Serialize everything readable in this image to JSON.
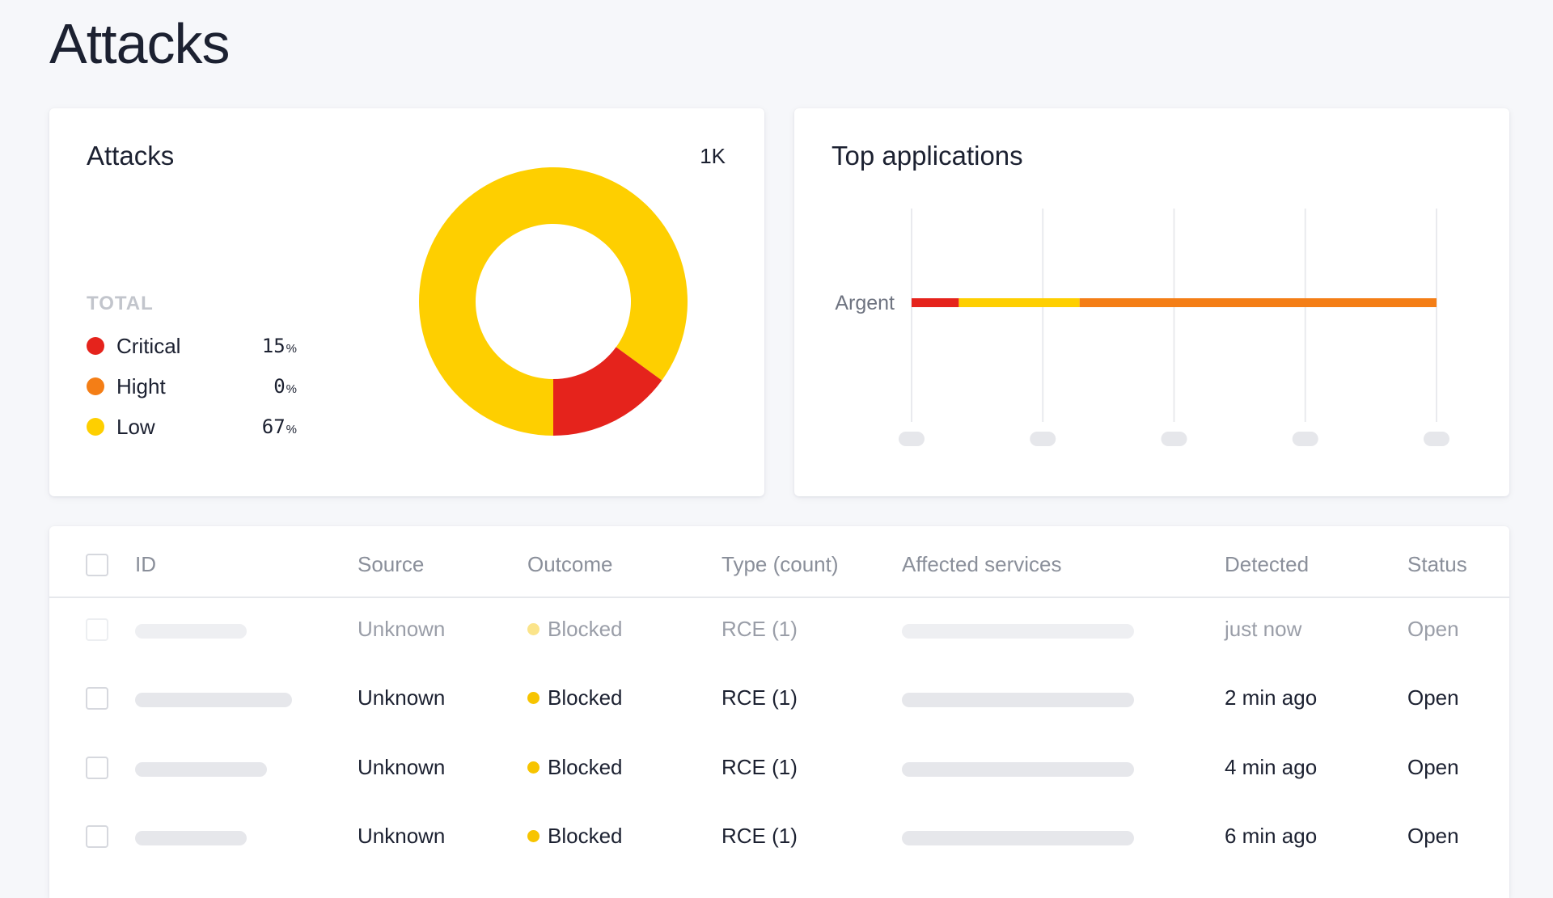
{
  "page": {
    "title": "Attacks"
  },
  "attacks_card": {
    "title": "Attacks",
    "count": "1K",
    "total_label": "TOTAL",
    "legend": [
      {
        "name": "Critical",
        "value": "15",
        "unit": "%",
        "color": "#e5231c"
      },
      {
        "name": "Hight",
        "value": "0",
        "unit": "%",
        "color": "#f47e16"
      },
      {
        "name": "Low",
        "value": "67",
        "unit": "%",
        "color": "#fecf00"
      }
    ]
  },
  "apps_card": {
    "title": "Top applications"
  },
  "chart_data": [
    {
      "type": "pie",
      "variant": "donut",
      "slices": [
        {
          "label": "Low",
          "value": 85,
          "color": "#fecf00"
        },
        {
          "label": "Critical",
          "value": 15,
          "color": "#e5231c"
        }
      ]
    },
    {
      "type": "bar",
      "orientation": "horizontal",
      "stacked": true,
      "categories": [
        "Argent"
      ],
      "series": [
        {
          "values": [
            9
          ],
          "color": "#e5231c"
        },
        {
          "values": [
            23
          ],
          "color": "#fecf00"
        },
        {
          "values": [
            68
          ],
          "color": "#f47e16"
        }
      ],
      "grid": true
    }
  ],
  "table": {
    "columns": [
      "ID",
      "Source",
      "Outcome",
      "Type (count)",
      "Affected services",
      "Detected",
      "Status"
    ],
    "rows": [
      {
        "source": "Unknown",
        "outcome": "Blocked",
        "type": "RCE (1)",
        "detected": "just now",
        "status": "Open"
      },
      {
        "source": "Unknown",
        "outcome": "Blocked",
        "type": "RCE (1)",
        "detected": "2 min ago",
        "status": "Open"
      },
      {
        "source": "Unknown",
        "outcome": "Blocked",
        "type": "RCE (1)",
        "detected": "4 min ago",
        "status": "Open"
      },
      {
        "source": "Unknown",
        "outcome": "Blocked",
        "type": "RCE (1)",
        "detected": "6 min ago",
        "status": "Open"
      }
    ]
  }
}
